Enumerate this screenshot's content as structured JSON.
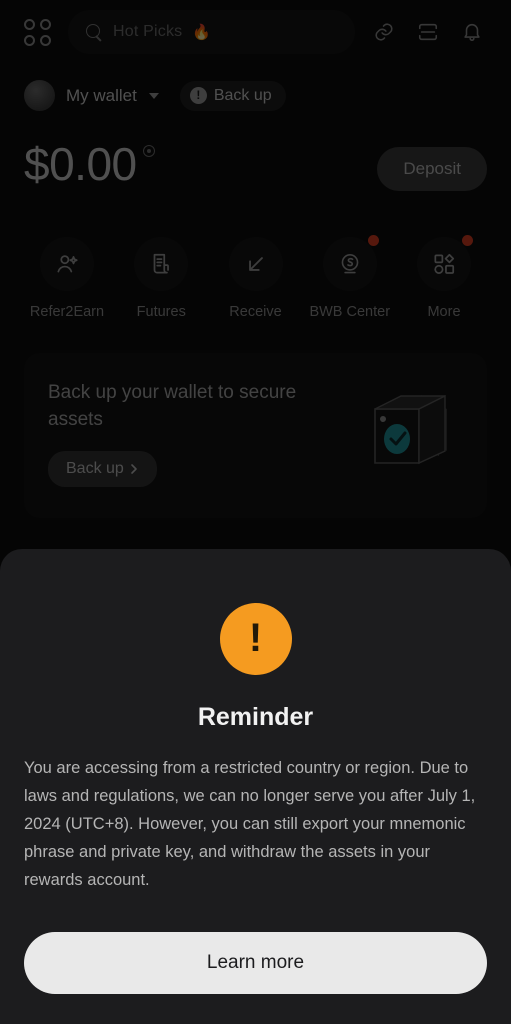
{
  "topbar": {
    "menu_icon": "grid-circles-icon",
    "search": {
      "value": "Hot Picks",
      "emoji": "🔥",
      "icon": "search-icon"
    },
    "icons": [
      {
        "name": "link-icon"
      },
      {
        "name": "scan-icon"
      },
      {
        "name": "bell-icon"
      }
    ]
  },
  "wallet": {
    "avatar": "avatar",
    "name": "My wallet",
    "chevron": "chevron-down-icon",
    "backup_pill": {
      "label": "Back up",
      "icon": "warning-icon"
    }
  },
  "balance": {
    "amount": "$0.00",
    "eye_icon": "eye-icon",
    "deposit_label": "Deposit"
  },
  "actions": [
    {
      "label": "Refer2Earn",
      "icon": "user-plus-icon",
      "badge": false
    },
    {
      "label": "Futures",
      "icon": "document-icon",
      "badge": false
    },
    {
      "label": "Receive",
      "icon": "arrow-down-left-icon",
      "badge": false
    },
    {
      "label": "BWB Center",
      "icon": "bwb-logo-icon",
      "badge": true
    },
    {
      "label": "More",
      "icon": "grid-shapes-icon",
      "badge": true
    }
  ],
  "backup_card": {
    "title": "Back up your wallet to secure assets",
    "button_label": "Back up",
    "button_chevron": "chevron-right-icon",
    "illustration": "notebook-check-icon"
  },
  "modal": {
    "icon": "exclamation-circle-icon",
    "title": "Reminder",
    "body": "You are accessing from a restricted country or region. Due to laws and regulations, we can no longer serve you after July 1, 2024 (UTC+8). However, you can still export your mnemonic phrase and private key, and withdraw the assets in your rewards account.",
    "primary_label": "Learn more"
  },
  "colors": {
    "page_bg": "#050505",
    "sheet_bg": "#1c1c1e",
    "warning_orange": "#f59b20",
    "badge_red": "#d63b20",
    "button_light": "#e9e9e9",
    "accent_teal": "#1f8f95"
  }
}
